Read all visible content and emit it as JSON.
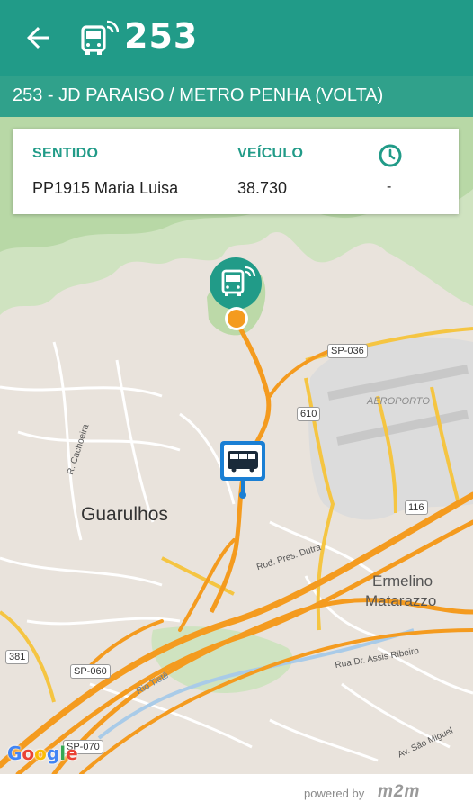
{
  "header": {
    "title": "253",
    "back_icon": "arrow-back-icon",
    "bus_icon": "bus-signal-icon",
    "color": "#219b88"
  },
  "route": {
    "name": "253 - JD PARAISO / METRO PENHA (VOLTA)"
  },
  "info": {
    "sentido_label": "SENTIDO",
    "sentido_value": "PP1915 Maria Luisa",
    "veiculo_label": "VEÍCULO",
    "veiculo_value": "38.730",
    "time_icon": "clock-icon",
    "time_value": "-"
  },
  "map": {
    "labels": {
      "city": "Guarulhos",
      "district_line1": "Ermelino",
      "district_line2": "Matarazzo",
      "airport": "AEROPORTO",
      "road_dutra": "Rod. Pres. Dutra",
      "road_assis": "Rua Dr. Assis Ribeiro",
      "river": "Rio Tietê",
      "street_cachoeira": "R. Cachoeira",
      "av_sao_miguel": "Av. São Miguel"
    },
    "shields": {
      "sp036": "SP-036",
      "s610": "610",
      "s116": "116",
      "s381": "381",
      "sp060": "SP-060",
      "sp070": "SP-070"
    },
    "google": "Google"
  },
  "footer": {
    "powered": "powered by",
    "brand": "m2m"
  }
}
